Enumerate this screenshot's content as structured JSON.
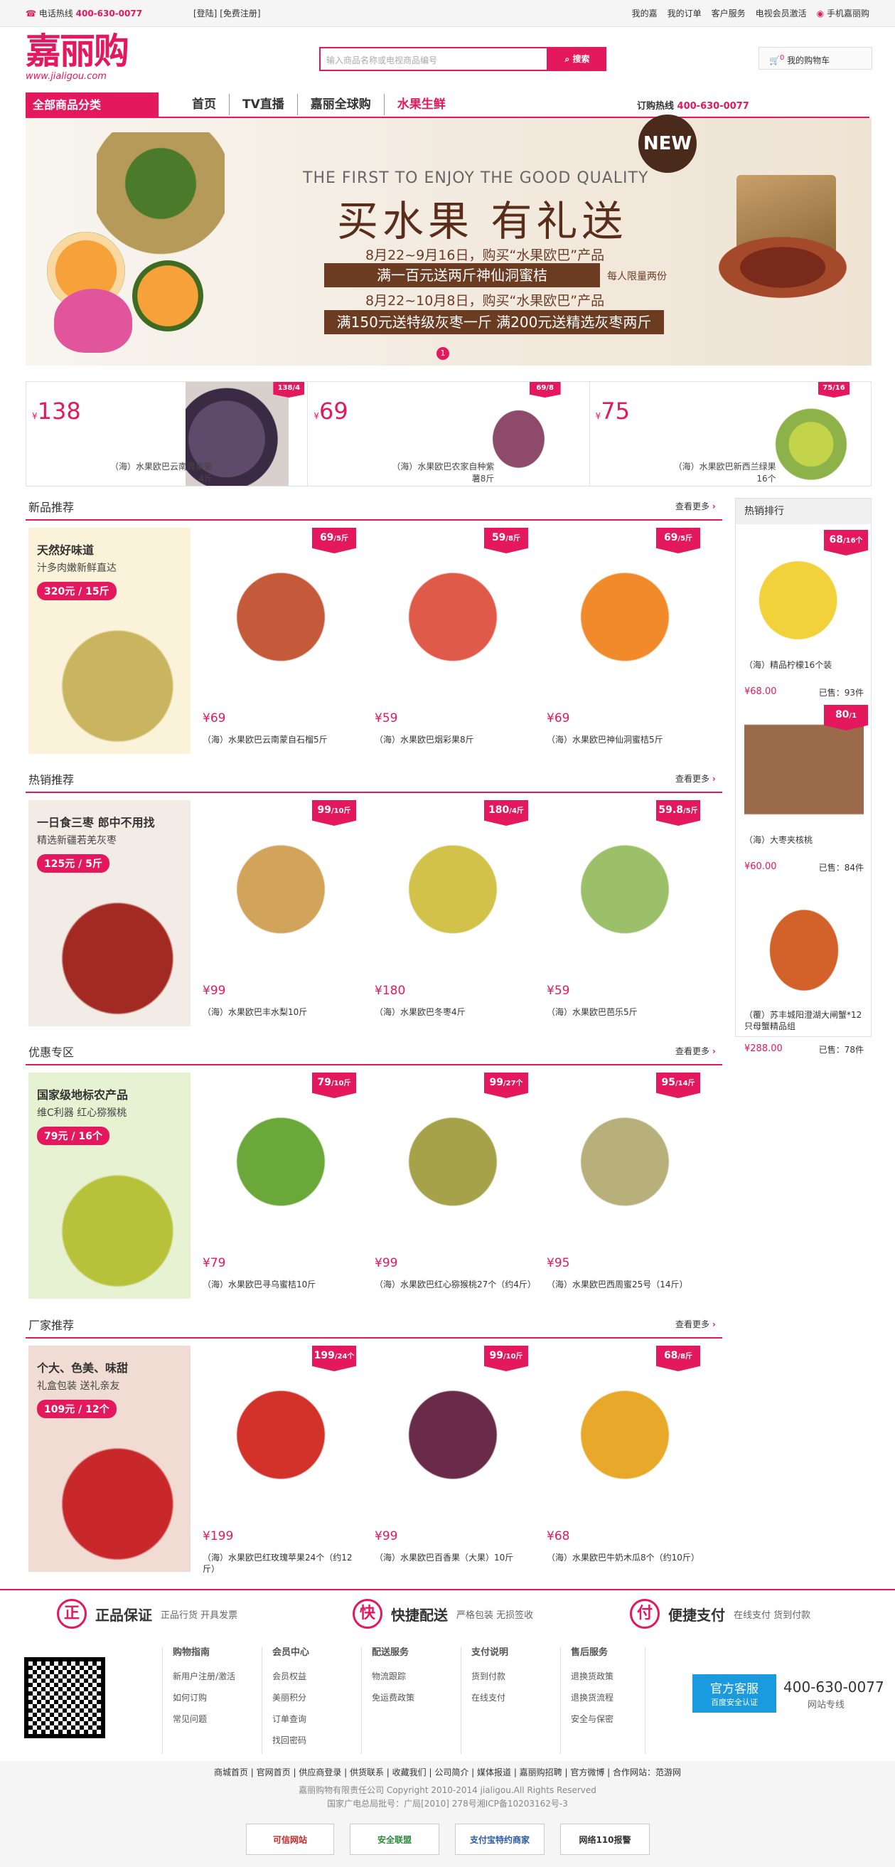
{
  "topbar": {
    "hotline_label": "电话热线",
    "hotline_number": "400-630-0077",
    "login": "[登陆]",
    "register": "[免费注册]",
    "links": [
      "我的嘉",
      "我的订单",
      "客户服务",
      "电视会员激活",
      "手机嘉丽购"
    ]
  },
  "header": {
    "logo_text": "嘉丽购",
    "logo_url": "www.jialigou.com",
    "search_placeholder": "输入商品名称或电视商品编号",
    "search_button": "搜索",
    "cart_label": "我的购物车",
    "cart_count": "0"
  },
  "nav": {
    "categories": "全部商品分类",
    "items": [
      "首页",
      "TV直播",
      "嘉丽全球购",
      "水果生鲜"
    ],
    "order_label": "订购热线",
    "order_number": "400-630-0077"
  },
  "banner": {
    "en": "THE FIRST TO ENJOY THE GOOD QUALITY",
    "title": "买水果 有礼送",
    "line1": "8月22~9月16日，购买“水果欧巴”产品",
    "box1": "满一百元送两斤神仙洞蜜桔",
    "box1_note": "每人限量两份",
    "line2": "8月22~10月8日，购买“水果欧巴”产品",
    "box2": "满150元送特级灰枣一斤 满200元送精选灰枣两斤",
    "new": "NEW",
    "page": "1"
  },
  "promos": [
    {
      "price": "138",
      "name": "（海）水果欧巴云南青果葡4斤",
      "tag": "138/4",
      "color": "#5e4a6b"
    },
    {
      "price": "69",
      "name": "（海）水果欧巴农家自种紫薯8斤",
      "tag": "69/8",
      "color": "#8d4a6a"
    },
    {
      "price": "75",
      "name": "（海）水果欧巴新西兰绿果16个",
      "tag": "75/16",
      "color": "#8db24a"
    }
  ],
  "currency": "¥",
  "sections": [
    {
      "title": "新品推荐",
      "more": "查看更多",
      "big": {
        "title": "天然好味道",
        "sub": "汁多肉嫩新鲜直达",
        "price": "320元 / 15斤",
        "bg": "#fbf3d9",
        "color": "#c9b560"
      },
      "items": [
        {
          "price": "69",
          "name": "（海）水果欧巴云南蒙自石榴5斤",
          "tag": "69",
          "unit": "5斤",
          "color": "#c45a3a"
        },
        {
          "price": "59",
          "name": "（海）水果欧巴烟彩果8斤",
          "tag": "59",
          "unit": "8斤",
          "color": "#e05a4a"
        },
        {
          "price": "69",
          "name": "（海）水果欧巴神仙洞蜜桔5斤",
          "tag": "69",
          "unit": "5斤",
          "color": "#f08a2a"
        }
      ]
    },
    {
      "title": "热销推荐",
      "more": "查看更多",
      "big": {
        "title": "一日食三枣 郎中不用找",
        "sub": "精选新疆若羌灰枣",
        "price": "125元 / 5斤",
        "bg": "#f3ece6",
        "color": "#a32a22"
      },
      "items": [
        {
          "price": "99",
          "name": "（海）水果欧巴丰水梨10斤",
          "tag": "99",
          "unit": "10斤",
          "color": "#d2a35a"
        },
        {
          "price": "180",
          "name": "（海）水果欧巴冬枣4斤",
          "tag": "180",
          "unit": "4斤",
          "color": "#d2c24a"
        },
        {
          "price": "59",
          "name": "（海）水果欧巴芭乐5斤",
          "tag": "59.8",
          "unit": "5斤",
          "color": "#9cbf6a"
        }
      ]
    },
    {
      "title": "优惠专区",
      "more": "查看更多",
      "big": {
        "title": "国家级地标农产品",
        "sub": "维C利器 红心猕猴桃",
        "price": "79元 / 16个",
        "bg": "#e6f2d2",
        "color": "#b7c23a"
      },
      "items": [
        {
          "price": "79",
          "name": "（海）水果欧巴寻乌蜜桔10斤",
          "tag": "79",
          "unit": "10斤",
          "color": "#6aa83a"
        },
        {
          "price": "99",
          "name": "（海）水果欧巴红心猕猴桃27个（约4斤）",
          "tag": "99",
          "unit": "27个",
          "color": "#a5a24a"
        },
        {
          "price": "95",
          "name": "（海）水果欧巴西周蜜25号（14斤）",
          "tag": "95",
          "unit": "14斤",
          "color": "#b8b07a"
        }
      ]
    },
    {
      "title": "厂家推荐",
      "more": "查看更多",
      "big": {
        "title": "个大、色美、味甜",
        "sub": "礼盒包装 送礼亲友",
        "price": "109元 / 12个",
        "bg": "#f0dcd2",
        "color": "#c8282a"
      },
      "items": [
        {
          "price": "199",
          "name": "（海）水果欧巴红玫瑰苹果24个（约12斤）",
          "tag": "199",
          "unit": "24个",
          "color": "#d2322a"
        },
        {
          "price": "99",
          "name": "（海）水果欧巴百香果（大果）10斤",
          "tag": "99",
          "unit": "10斤",
          "color": "#6a2a4a"
        },
        {
          "price": "68",
          "name": "（海）水果欧巴牛奶木瓜8个（约10斤）",
          "tag": "68",
          "unit": "8斤",
          "color": "#e8a82a"
        }
      ]
    }
  ],
  "sidebar": {
    "title": "热销排行",
    "items": [
      {
        "name": "（海）精品柠檬16个装",
        "price": "68.00",
        "sold": "已售：93件",
        "tag": "68",
        "unit": "16个",
        "color": "#f2d23a"
      },
      {
        "name": "（海）大枣夹核桃",
        "price": "60.00",
        "sold": "已售：84件",
        "tag": "80",
        "unit": "1",
        "color": "#7a4a32"
      },
      {
        "name": "（覆）苏丰城阳澄湖大闸蟹*12只母蟹精品组",
        "price": "288.00",
        "sold": "已售：78件",
        "tag": "",
        "unit": "",
        "color": "#d2622a"
      }
    ]
  },
  "guarantees": [
    {
      "icon": "正",
      "title": "正品保证",
      "sub": "正品行货 开具发票"
    },
    {
      "icon": "快",
      "title": "快捷配送",
      "sub": "严格包装 无损签收"
    },
    {
      "icon": "付",
      "title": "便捷支付",
      "sub": "在线支付 货到付款"
    }
  ],
  "footer": {
    "cols": [
      {
        "h": "购物指南",
        "items": [
          "新用户注册/激活",
          "如何订购",
          "常见问题"
        ]
      },
      {
        "h": "会员中心",
        "items": [
          "会员权益",
          "美丽积分",
          "订单查询",
          "找回密码"
        ]
      },
      {
        "h": "配送服务",
        "items": [
          "物流跟踪",
          "免运费政策"
        ]
      },
      {
        "h": "支付说明",
        "items": [
          "货到付款",
          "在线支付"
        ]
      },
      {
        "h": "售后服务",
        "items": [
          "退换货政策",
          "退换货流程",
          "安全与保密"
        ]
      }
    ],
    "kefu": "官方客服",
    "kefu_sub": "百度安全认证",
    "tel": "400-630-0077",
    "tel_label": "网站专线",
    "links": "商城首页 | 官网首页 | 供应商登录 | 供货联系 | 收藏我们 | 公司简介 | 媒体报道 | 嘉丽购招聘 | 官方微博 | 合作网站：范游网",
    "copyright": "嘉丽购物有限责任公司 Copyright 2010-2014 jialigou.All Rights Reserved",
    "icp": "国家广电总局批号：广局[2010] 278号湘ICP备10203162号-3",
    "badges": [
      "可信网站",
      "安全联盟",
      "支付宝特约商家",
      "网络110报警"
    ]
  }
}
